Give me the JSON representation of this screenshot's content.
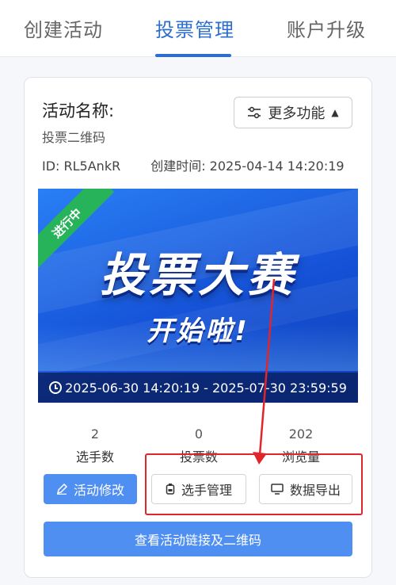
{
  "tabs": [
    {
      "label": "创建活动"
    },
    {
      "label": "投票管理"
    },
    {
      "label": "账户升级"
    }
  ],
  "activity": {
    "name_label": "活动名称:",
    "name_value": "投票二维码",
    "id_text": "ID:  RL5AnkR",
    "created_text": "创建时间:  2025-04-14 14:20:19"
  },
  "more_button": {
    "label": "更多功能"
  },
  "banner": {
    "status_ribbon": "进行中",
    "title": "投票大赛",
    "subtitle": "开始啦!",
    "time_range": "2025-06-30 14:20:19 - 2025-07-30 23:59:59"
  },
  "stats": [
    {
      "value": "2",
      "label": "选手数"
    },
    {
      "value": "0",
      "label": "投票数"
    },
    {
      "value": "202",
      "label": "浏览量"
    }
  ],
  "buttons": {
    "edit": "活动修改",
    "players": "选手管理",
    "export": "数据导出",
    "link_qr": "查看活动链接及二维码"
  },
  "colors": {
    "accent": "#2c6ed0",
    "primary_button": "#4f8ff1",
    "annotation_red": "#e0262b",
    "ribbon_green": "#27b35a"
  }
}
